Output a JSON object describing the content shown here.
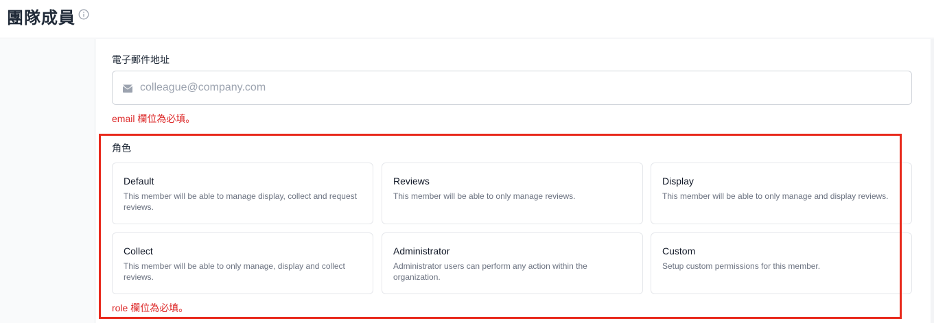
{
  "header": {
    "title": "團隊成員",
    "info_icon": "info-circle-icon"
  },
  "form": {
    "email": {
      "label": "電子郵件地址",
      "placeholder": "colleague@company.com",
      "value": "",
      "icon": "mail-icon",
      "error": "email 欄位為必填。"
    },
    "role": {
      "label": "角色",
      "error": "role 欄位為必填。",
      "options": [
        {
          "title": "Default",
          "description": "This member will be able to manage display, collect and request reviews."
        },
        {
          "title": "Reviews",
          "description": "This member will be able to only manage reviews."
        },
        {
          "title": "Display",
          "description": "This member will be able to only manage and display reviews."
        },
        {
          "title": "Collect",
          "description": "This member will be able to only manage, display and collect reviews."
        },
        {
          "title": "Administrator",
          "description": "Administrator users can perform any action within the organization."
        },
        {
          "title": "Custom",
          "description": "Setup custom permissions for this member."
        }
      ]
    }
  },
  "colors": {
    "error": "#dc2626",
    "highlight": "#e8291c",
    "border": "#e5e7eb"
  }
}
